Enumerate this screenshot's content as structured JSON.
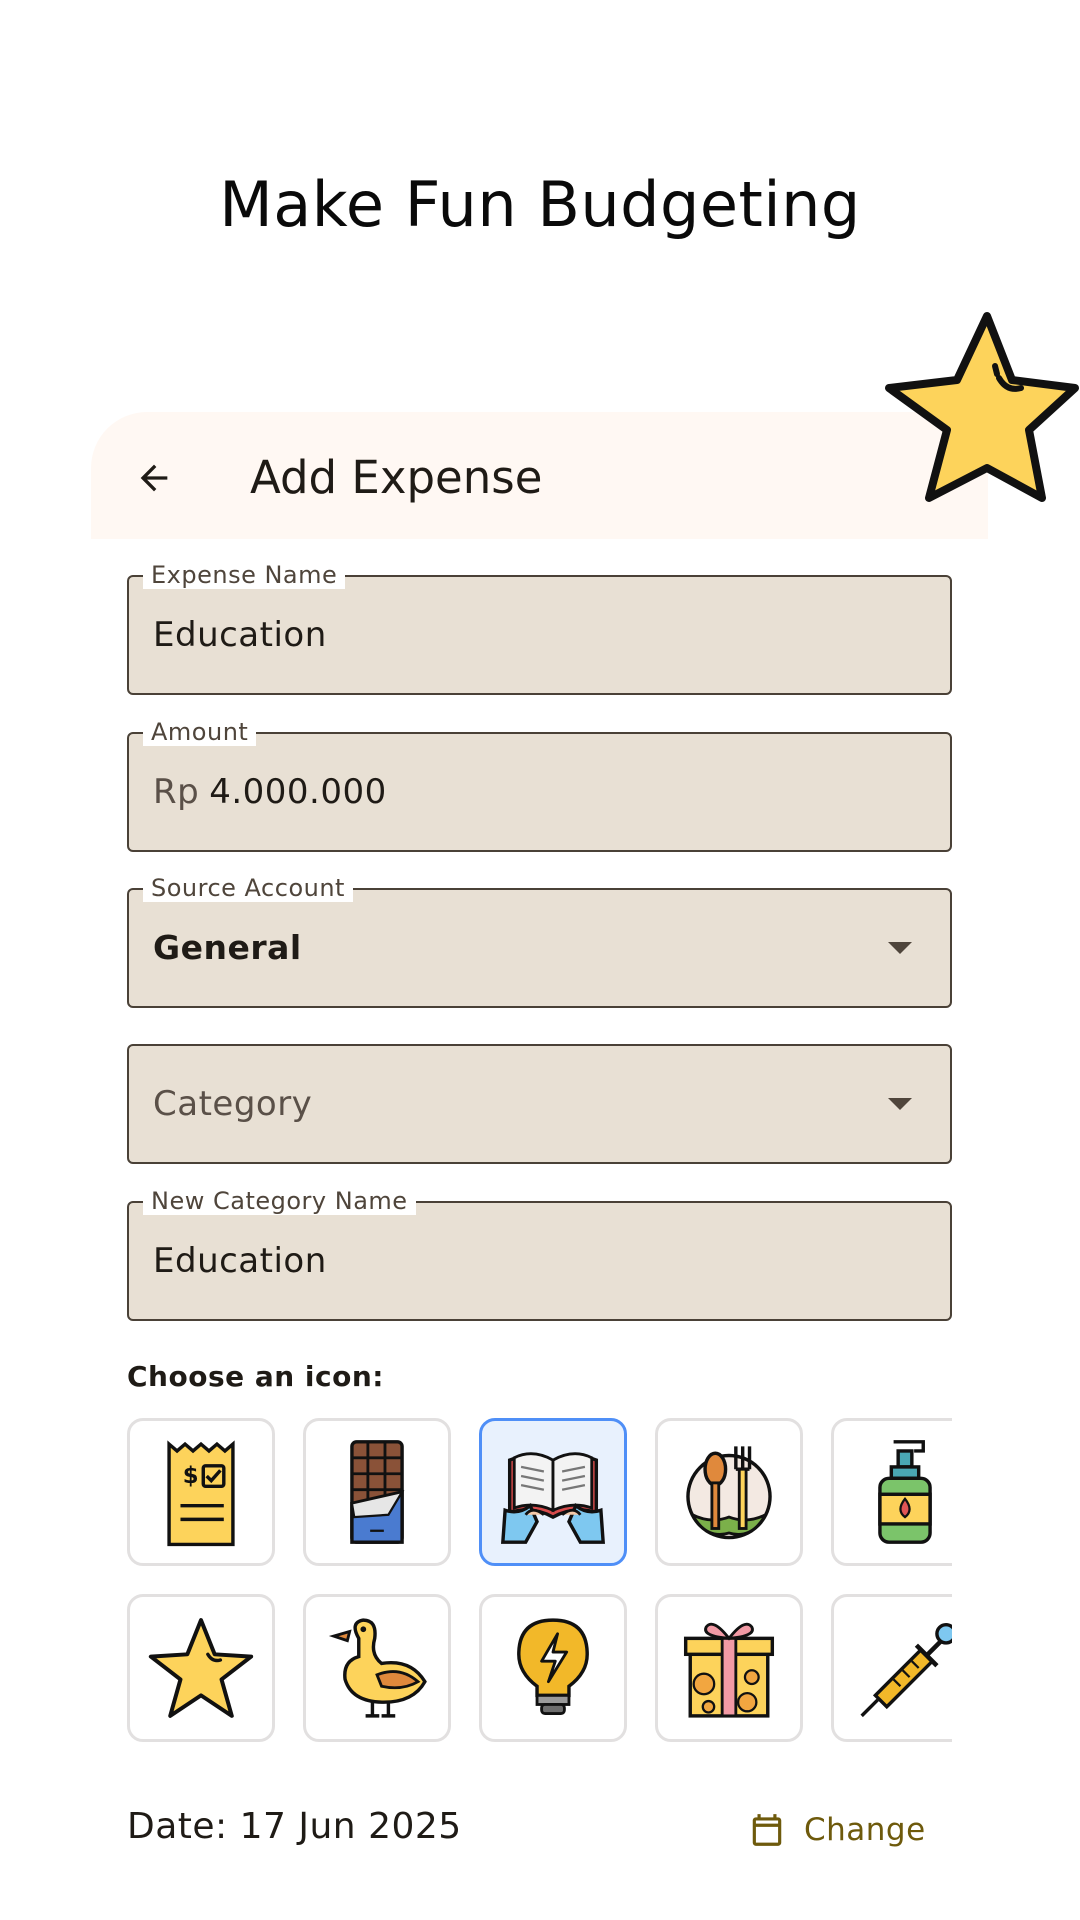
{
  "headline": "Make Fun Budgeting",
  "appbar": {
    "title": "Add Expense"
  },
  "form": {
    "expense_name": {
      "label": "Expense Name",
      "value": "Education"
    },
    "amount": {
      "label": "Amount",
      "prefix": "Rp",
      "value": "4.000.000"
    },
    "source_account": {
      "label": "Source Account",
      "value": "General"
    },
    "category": {
      "placeholder": "Category"
    },
    "new_category": {
      "label": "New Category Name",
      "value": "Education"
    }
  },
  "icon_picker": {
    "label": "Choose an icon:",
    "icons": [
      {
        "name": "receipt-icon",
        "selected": false
      },
      {
        "name": "chocolate-bar-icon",
        "selected": false
      },
      {
        "name": "open-book-icon",
        "selected": true
      },
      {
        "name": "food-plate-icon",
        "selected": false
      },
      {
        "name": "soap-bottle-icon",
        "selected": false
      },
      {
        "name": "star-icon",
        "selected": false
      },
      {
        "name": "duck-icon",
        "selected": false
      },
      {
        "name": "lightbulb-icon",
        "selected": false
      },
      {
        "name": "gift-box-icon",
        "selected": false
      },
      {
        "name": "syringe-icon",
        "selected": false
      }
    ]
  },
  "date": {
    "text": "Date: 17 Jun 2025",
    "change_label": "Change"
  },
  "colors": {
    "accent_selected": "#4f8ff7",
    "field_fill": "#e8e0d4",
    "change_text": "#6e5a0c",
    "star_yellow": "#fdd35b"
  }
}
